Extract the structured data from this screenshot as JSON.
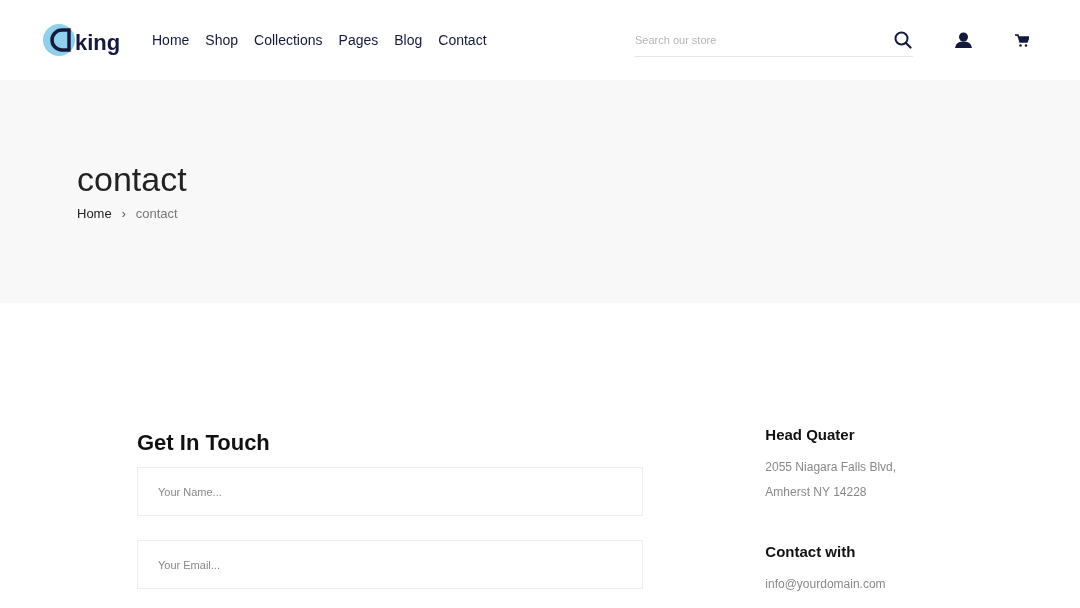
{
  "header": {
    "logo_text": "king",
    "nav": [
      {
        "label": "Home"
      },
      {
        "label": "Shop"
      },
      {
        "label": "Collections"
      },
      {
        "label": "Pages"
      },
      {
        "label": "Blog"
      },
      {
        "label": "Contact"
      }
    ],
    "search": {
      "placeholder": "Search our store"
    }
  },
  "banner": {
    "title": "contact",
    "breadcrumb": [
      {
        "label": "Home",
        "current": false
      },
      {
        "label": "contact",
        "current": true
      }
    ],
    "separator": "›"
  },
  "form": {
    "title": "Get In Touch",
    "fields": [
      {
        "placeholder": "Your Name..."
      },
      {
        "placeholder": "Your Email..."
      }
    ]
  },
  "info": [
    {
      "title": "Head Quater",
      "lines": [
        "2055 Niagara Falls Blvd,",
        "Amherst NY 14228"
      ]
    },
    {
      "title": "Contact with",
      "lines": [
        "info@yourdomain.com"
      ]
    }
  ]
}
